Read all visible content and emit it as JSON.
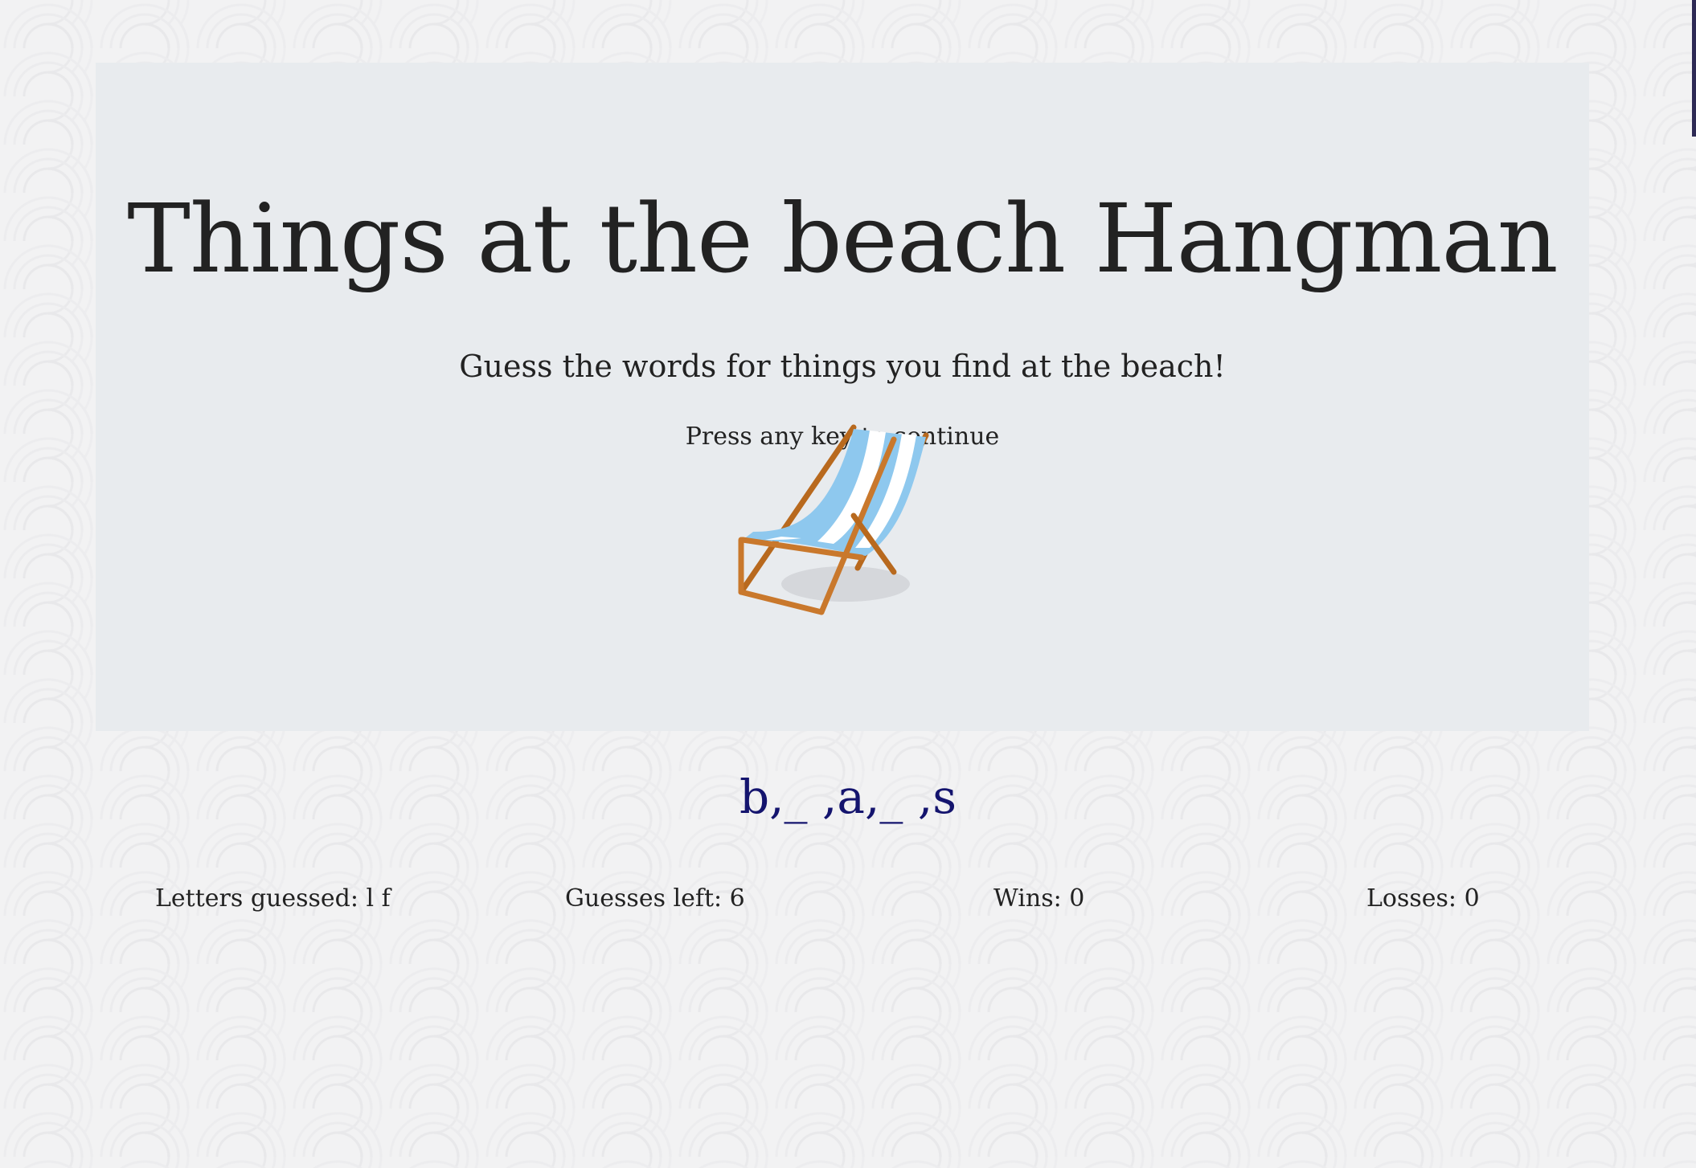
{
  "header": {
    "title": "Things at the beach Hangman",
    "subtitle": "Guess the words for things you find at the beach!",
    "prompt": "Press any key to continue",
    "image_icon": "beach-chair-icon"
  },
  "game": {
    "word_display": "b,_ ,a,_ ,s"
  },
  "stats": {
    "letters_guessed": "Letters guessed: l f",
    "guesses_left": "Guesses left: 6",
    "wins": "Wins: 0",
    "losses": "Losses: 0"
  },
  "colors": {
    "word_color": "#14146e",
    "panel_bg": "#e8ebee",
    "page_bg": "#f2f2f3",
    "chair_stripe_blue": "#7fbfe9",
    "chair_frame": "#c9782c"
  }
}
